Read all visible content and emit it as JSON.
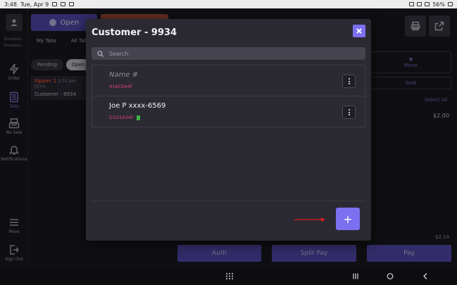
{
  "status_bar": {
    "time": "3:48",
    "date": "Tue, Apr 9",
    "battery": "56%"
  },
  "rail": {
    "user_lines": [
      "Knowled...",
      "Knowled..."
    ],
    "items": [
      {
        "label": "Order",
        "icon": "lightning-icon"
      },
      {
        "label": "Tabs",
        "icon": "tabs-icon",
        "active": true
      },
      {
        "label": "No Sale",
        "icon": "cash-register-icon"
      },
      {
        "label": "Notifications",
        "icon": "bell-icon"
      },
      {
        "label": "More",
        "icon": "menu-icon"
      },
      {
        "label": "Sign Out",
        "icon": "sign-out-icon"
      }
    ]
  },
  "background": {
    "open_button": "Open",
    "tabs": [
      "My Tabs",
      "All Tab"
    ],
    "filters": [
      "Pending",
      "Open"
    ],
    "tab_card": {
      "name": "Upper 1",
      "time": "2:51 pm [57m",
      "customer": "Customer - 9934"
    },
    "right_panel": {
      "move_label": "Move",
      "seat_label": "Seat",
      "select_all": "Select All",
      "amount": "$2.00",
      "total": "$2.14"
    },
    "footer_buttons": [
      "Auth",
      "Split Pay",
      "Pay"
    ]
  },
  "modal": {
    "title": "Customer - 9934",
    "search_placeholder": "Search",
    "items": [
      {
        "name": "Name #",
        "code": "41AC944F",
        "is_placeholder": true,
        "has_doc": false
      },
      {
        "name": "Joe P  xxxx-6569",
        "code": "D1D1A34F",
        "is_placeholder": false,
        "has_doc": true
      }
    ],
    "add_label": "+"
  },
  "colors": {
    "accent": "#7c6ff0",
    "code": "#e0407a",
    "arrow": "#e02020"
  }
}
